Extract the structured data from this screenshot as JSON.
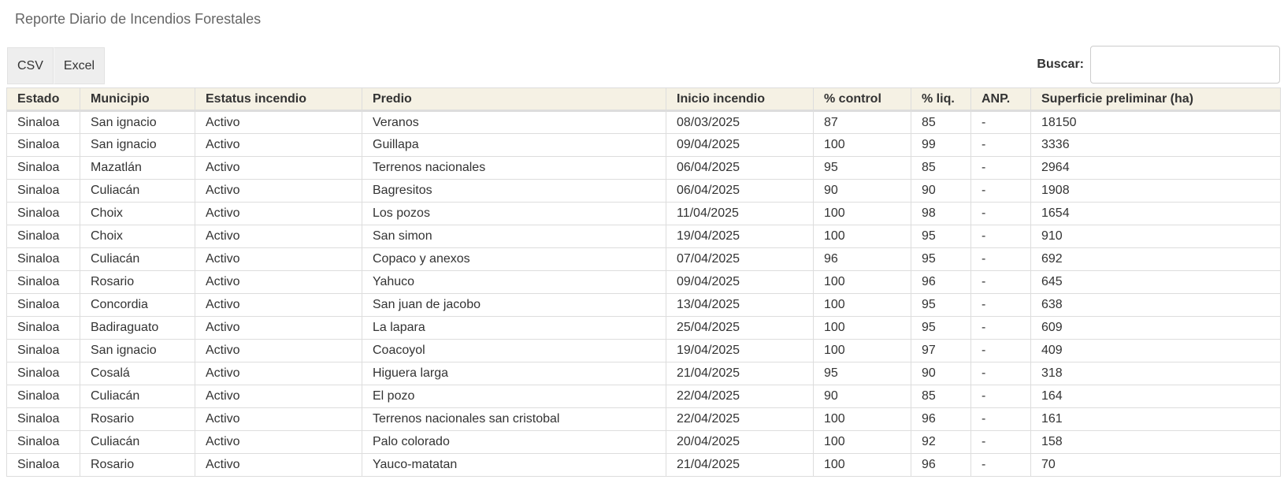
{
  "page": {
    "title": "Reporte Diario de Incendios Forestales"
  },
  "toolbar": {
    "csv_label": "CSV",
    "excel_label": "Excel"
  },
  "search": {
    "label": "Buscar:",
    "value": "",
    "placeholder": ""
  },
  "table": {
    "headers": [
      "Estado",
      "Municipio",
      "Estatus incendio",
      "Predio",
      "Inicio incendio",
      "% control",
      "% liq.",
      "ANP.",
      "Superficie preliminar (ha)"
    ],
    "rows": [
      [
        "Sinaloa",
        "San ignacio",
        "Activo",
        "Veranos",
        "08/03/2025",
        "87",
        "85",
        "-",
        "18150"
      ],
      [
        "Sinaloa",
        "San ignacio",
        "Activo",
        "Guillapa",
        "09/04/2025",
        "100",
        "99",
        "-",
        "3336"
      ],
      [
        "Sinaloa",
        "Mazatlán",
        "Activo",
        "Terrenos nacionales",
        "06/04/2025",
        "95",
        "85",
        "-",
        "2964"
      ],
      [
        "Sinaloa",
        "Culiacán",
        "Activo",
        "Bagresitos",
        "06/04/2025",
        "90",
        "90",
        "-",
        "1908"
      ],
      [
        "Sinaloa",
        "Choix",
        "Activo",
        "Los pozos",
        "11/04/2025",
        "100",
        "98",
        "-",
        "1654"
      ],
      [
        "Sinaloa",
        "Choix",
        "Activo",
        "San simon",
        "19/04/2025",
        "100",
        "95",
        "-",
        "910"
      ],
      [
        "Sinaloa",
        "Culiacán",
        "Activo",
        "Copaco y anexos",
        "07/04/2025",
        "96",
        "95",
        "-",
        "692"
      ],
      [
        "Sinaloa",
        "Rosario",
        "Activo",
        "Yahuco",
        "09/04/2025",
        "100",
        "96",
        "-",
        "645"
      ],
      [
        "Sinaloa",
        "Concordia",
        "Activo",
        "San juan de jacobo",
        "13/04/2025",
        "100",
        "95",
        "-",
        "638"
      ],
      [
        "Sinaloa",
        "Badiraguato",
        "Activo",
        "La lapara",
        "25/04/2025",
        "100",
        "95",
        "-",
        "609"
      ],
      [
        "Sinaloa",
        "San ignacio",
        "Activo",
        "Coacoyol",
        "19/04/2025",
        "100",
        "97",
        "-",
        "409"
      ],
      [
        "Sinaloa",
        "Cosalá",
        "Activo",
        "Higuera larga",
        "21/04/2025",
        "95",
        "90",
        "-",
        "318"
      ],
      [
        "Sinaloa",
        "Culiacán",
        "Activo",
        "El pozo",
        "22/04/2025",
        "90",
        "85",
        "-",
        "164"
      ],
      [
        "Sinaloa",
        "Rosario",
        "Activo",
        "Terrenos nacionales san cristobal",
        "22/04/2025",
        "100",
        "96",
        "-",
        "161"
      ],
      [
        "Sinaloa",
        "Culiacán",
        "Activo",
        "Palo colorado",
        "20/04/2025",
        "100",
        "92",
        "-",
        "158"
      ],
      [
        "Sinaloa",
        "Rosario",
        "Activo",
        "Yauco-matatan",
        "21/04/2025",
        "100",
        "96",
        "-",
        "70"
      ]
    ]
  }
}
